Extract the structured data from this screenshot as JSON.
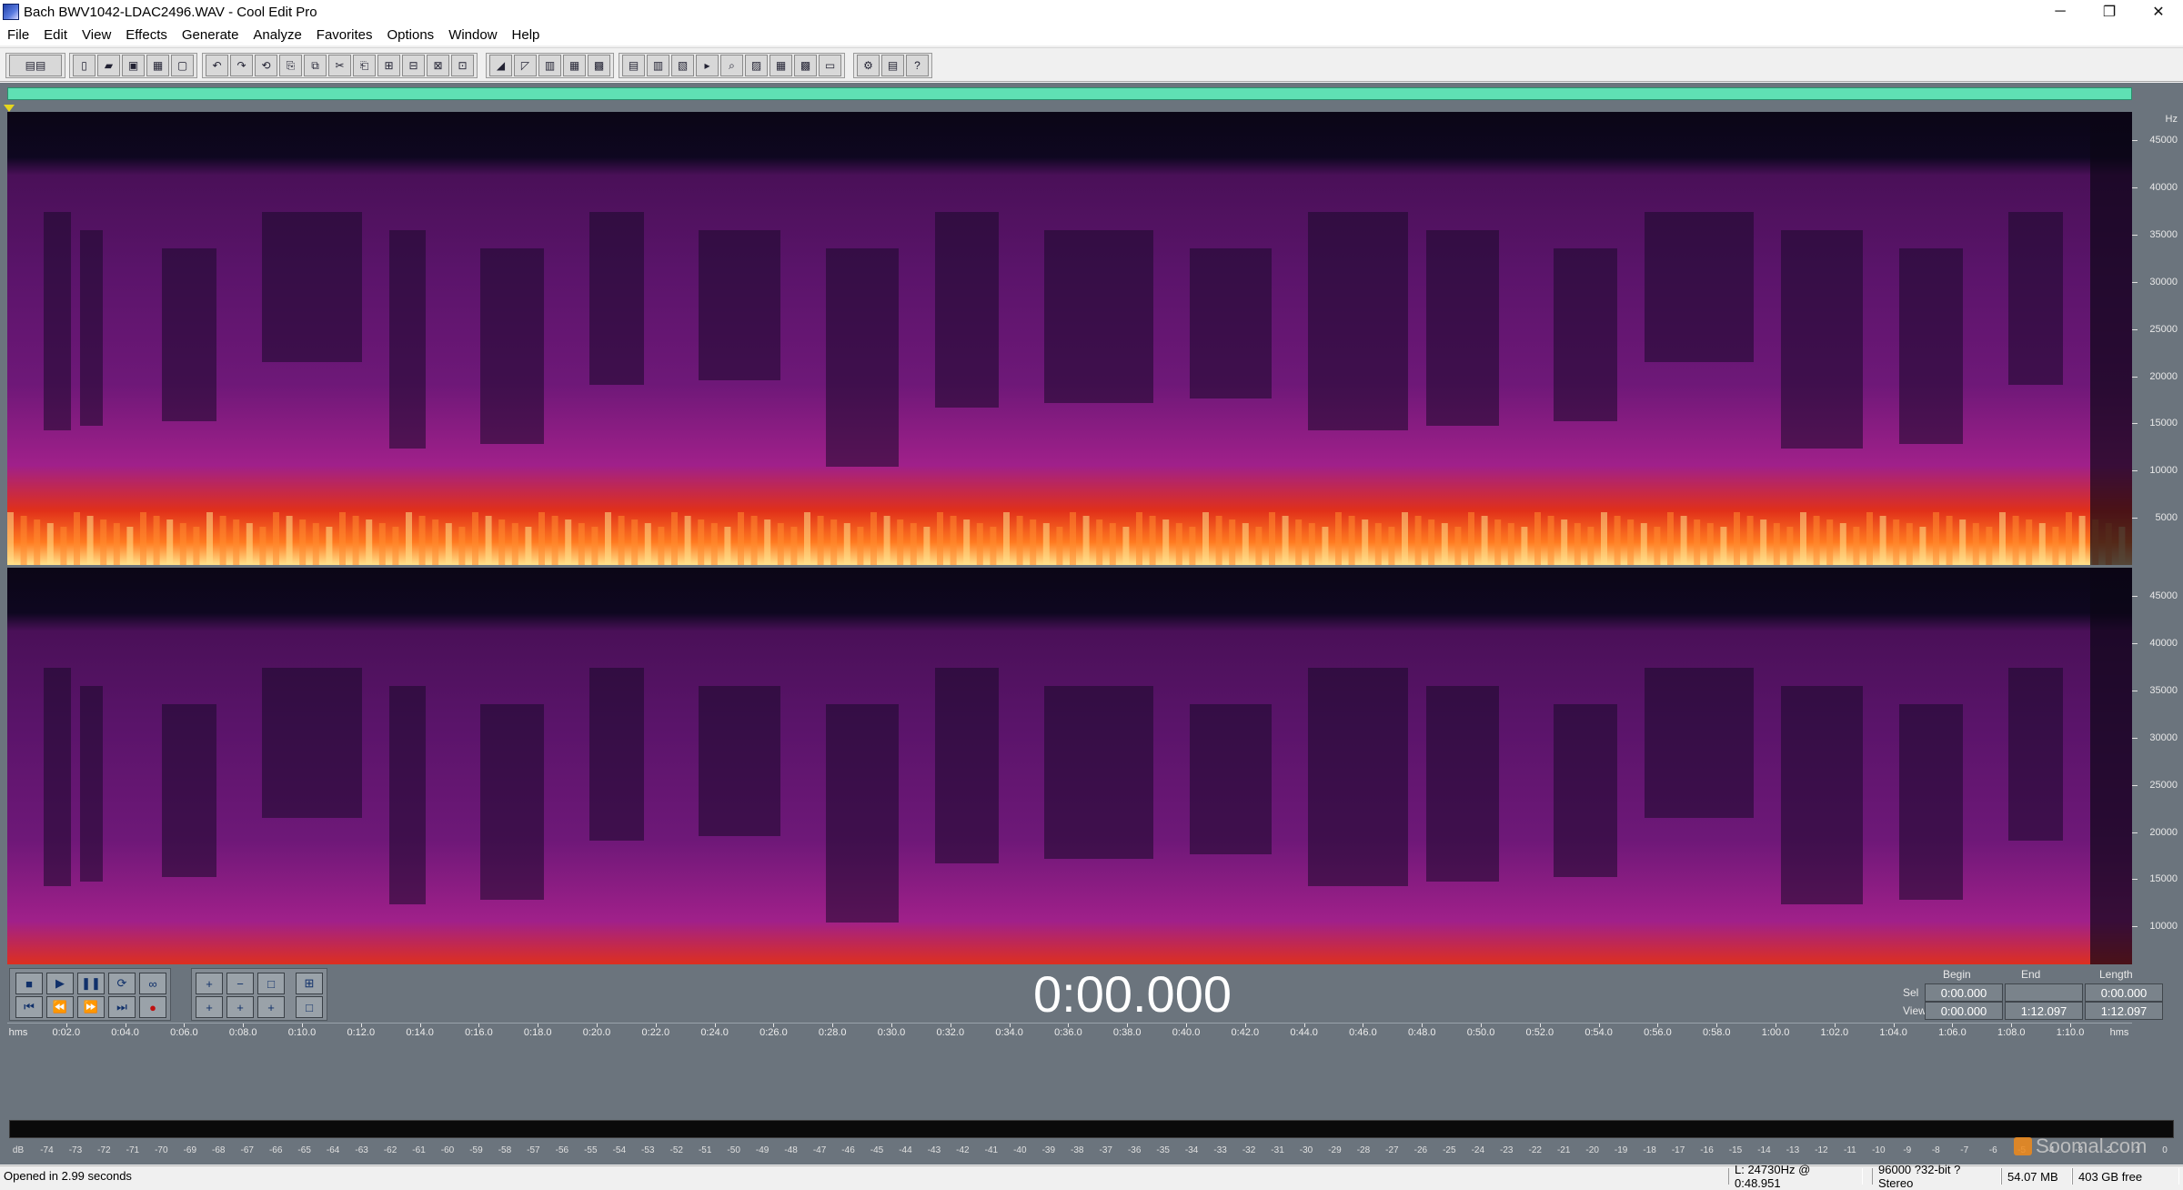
{
  "window": {
    "title": "Bach BWV1042-LDAC2496.WAV - Cool Edit Pro",
    "icon": "cool-edit-icon",
    "controls": [
      "─",
      "❐",
      "✕"
    ]
  },
  "menu": [
    "File",
    "Edit",
    "View",
    "Effects",
    "Generate",
    "Analyze",
    "Favorites",
    "Options",
    "Window",
    "Help"
  ],
  "spectrogram": {
    "view": "spectral",
    "colors": {
      "background": "#0b0616",
      "low": "#3a0a4a",
      "mid": "#8a1a8a",
      "high": "#e0301a",
      "peak": "#ffe08a"
    },
    "hz_unit_top": "Hz",
    "hz_unit_bottom": "Hz",
    "hz_ticks": [
      "45000",
      "40000",
      "35000",
      "30000",
      "25000",
      "20000",
      "15000",
      "10000",
      "5000"
    ],
    "hz_values": [
      45000,
      40000,
      35000,
      30000,
      25000,
      20000,
      15000,
      10000,
      5000
    ],
    "hz_max": 48000
  },
  "timeline": {
    "unit_left": "hms",
    "unit_right": "hms",
    "ticks": [
      "0:02.0",
      "0:04.0",
      "0:06.0",
      "0:08.0",
      "0:10.0",
      "0:12.0",
      "0:14.0",
      "0:16.0",
      "0:18.0",
      "0:20.0",
      "0:22.0",
      "0:24.0",
      "0:26.0",
      "0:28.0",
      "0:30.0",
      "0:32.0",
      "0:34.0",
      "0:36.0",
      "0:38.0",
      "0:40.0",
      "0:42.0",
      "0:44.0",
      "0:46.0",
      "0:48.0",
      "0:50.0",
      "0:52.0",
      "0:54.0",
      "0:56.0",
      "0:58.0",
      "1:00.0",
      "1:02.0",
      "1:04.0",
      "1:06.0",
      "1:08.0",
      "1:10.0"
    ],
    "duration_seconds": 72.097
  },
  "transport": {
    "time": "0:00.000",
    "buttons_row1": [
      "■",
      "▶",
      "❚❚",
      "⟳",
      "∞"
    ],
    "buttons_row2": [
      "⏮",
      "⏪",
      "⏩",
      "⏭",
      "●"
    ],
    "zoom_row1": [
      "+",
      "−",
      "□",
      "⊞"
    ],
    "zoom_row2": [
      "+",
      "+",
      "+",
      "□"
    ]
  },
  "selection": {
    "headers": {
      "begin": "Begin",
      "end": "End",
      "length": "Length"
    },
    "sel": {
      "label": "Sel",
      "begin": "0:00.000",
      "end": "",
      "length": "0:00.000"
    },
    "view": {
      "label": "View",
      "begin": "0:00.000",
      "end": "1:12.097",
      "length": "1:12.097"
    }
  },
  "level_meter": {
    "db_labels": [
      "dB",
      "-74",
      "-73",
      "-72",
      "-71",
      "-70",
      "-69",
      "-68",
      "-67",
      "-66",
      "-65",
      "-64",
      "-63",
      "-62",
      "-61",
      "-60",
      "-59",
      "-58",
      "-57",
      "-56",
      "-55",
      "-54",
      "-53",
      "-52",
      "-51",
      "-50",
      "-49",
      "-48",
      "-47",
      "-46",
      "-45",
      "-44",
      "-43",
      "-42",
      "-41",
      "-40",
      "-39",
      "-38",
      "-37",
      "-36",
      "-35",
      "-34",
      "-33",
      "-32",
      "-31",
      "-30",
      "-29",
      "-28",
      "-27",
      "-26",
      "-25",
      "-24",
      "-23",
      "-22",
      "-21",
      "-20",
      "-19",
      "-18",
      "-17",
      "-16",
      "-15",
      "-14",
      "-13",
      "-12",
      "-11",
      "-10",
      "-9",
      "-8",
      "-7",
      "-6",
      "-5",
      "-4",
      "-3",
      "-2",
      "-1",
      "0"
    ]
  },
  "watermark": "Soomal.com",
  "status": {
    "message": "Opened in 2.99 seconds",
    "cursor": "L: 24730Hz @  0:48.951",
    "format": "96000 ?32-bit ?Stereo",
    "size": "54.07 MB",
    "free": "403 GB free"
  }
}
